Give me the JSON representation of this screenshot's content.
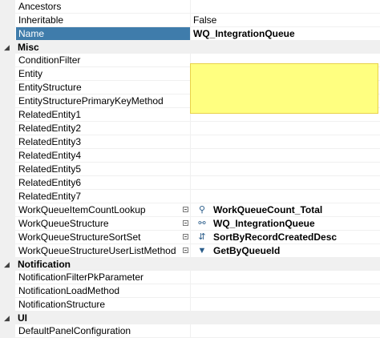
{
  "rows": {
    "ancestors": {
      "name": "Ancestors",
      "value": ""
    },
    "inheritable": {
      "name": "Inheritable",
      "value": "False"
    },
    "name": {
      "name": "Name",
      "value": "WQ_IntegrationQueue"
    }
  },
  "categories": {
    "misc": "Misc",
    "notification": "Notification",
    "ui": "UI"
  },
  "misc": {
    "condition_filter": "ConditionFilter",
    "entity": "Entity",
    "entity_structure": "EntityStructure",
    "entity_structure_pk_method": "EntityStructurePrimaryKeyMethod",
    "related_entity1": "RelatedEntity1",
    "related_entity2": "RelatedEntity2",
    "related_entity3": "RelatedEntity3",
    "related_entity4": "RelatedEntity4",
    "related_entity5": "RelatedEntity5",
    "related_entity6": "RelatedEntity6",
    "related_entity7": "RelatedEntity7",
    "count_lookup": {
      "name": "WorkQueueItemCountLookup",
      "value": "WorkQueueCount_Total"
    },
    "structure": {
      "name": "WorkQueueStructure",
      "value": "WQ_IntegrationQueue"
    },
    "sort_set": {
      "name": "WorkQueueStructureSortSet",
      "value": "SortByRecordCreatedDesc"
    },
    "user_list_method": {
      "name": "WorkQueueStructureUserListMethod",
      "value": "GetByQueueId"
    }
  },
  "notification": {
    "filter_pk": "NotificationFilterPkParameter",
    "load_method": "NotificationLoadMethod",
    "structure": "NotificationStructure"
  },
  "ui": {
    "default_panel": "DefaultPanelConfiguration"
  },
  "icons": {
    "collapse": "collapse-icon",
    "lookup": "lookup-icon",
    "structure": "structure-icon",
    "sort": "sort-icon",
    "filter_method": "filter-method-icon",
    "ellipsis": "ellipsis-button-icon"
  },
  "colors": {
    "selected_bg": "#3f7cab",
    "highlight": "#ffff80",
    "category_bg": "#f0f0f0"
  }
}
